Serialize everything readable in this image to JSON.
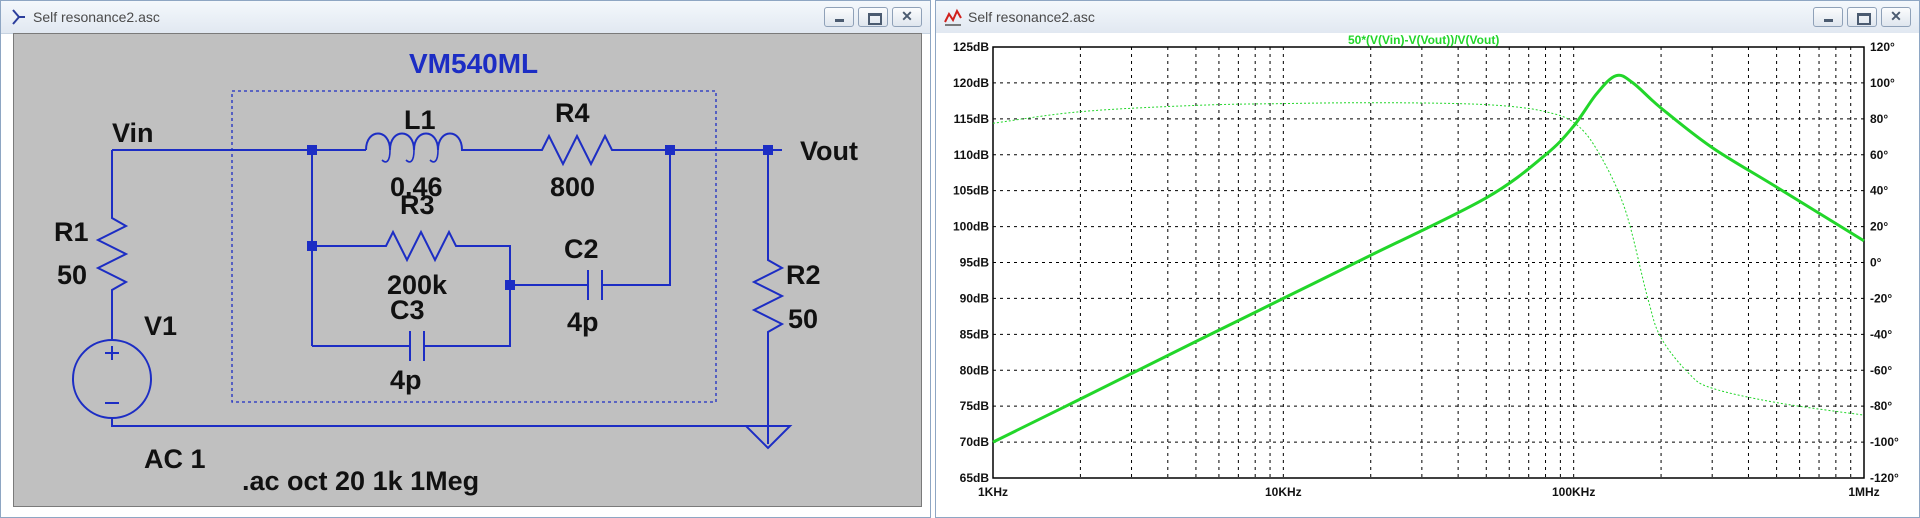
{
  "schematic_window": {
    "title": "Self resonance2.asc",
    "circuit_title": "VM540ML",
    "labels": {
      "vin": "Vin",
      "vout": "Vout",
      "r1_name": "R1",
      "r1_value": "50",
      "v1_name": "V1",
      "v1_value": "AC 1",
      "l1_name": "L1",
      "l1_value": "0.46",
      "r4_name": "R4",
      "r4_value": "800",
      "r3_name": "R3",
      "r3_value": "200k",
      "c2_name": "C2",
      "c2_value": "4p",
      "c3_name": "C3",
      "c3_value": "4p",
      "r2_name": "R2",
      "r2_value": "50",
      "directive": ".ac oct 20 1k 1Meg"
    },
    "colors": {
      "wire": "#1c2dc4",
      "component": "#1c2dc4",
      "background": "#c0c0c0"
    }
  },
  "plot_window": {
    "title": "Self resonance2.asc",
    "trace_label": "50*(V(Vin)-V(Vout))/V(Vout)",
    "colors": {
      "trace": "#22d62a",
      "grid": "#000000"
    },
    "chart_data": {
      "type": "line",
      "x_scale": "log",
      "xlim": [
        1000,
        1000000
      ],
      "x_ticks": [
        "1KHz",
        "10KHz",
        "100KHz",
        "1MHz"
      ],
      "x_tick_values": [
        1000,
        10000,
        100000,
        1000000
      ],
      "ylim_left": [
        65,
        125
      ],
      "y_ticks_left": [
        "125dB",
        "120dB",
        "115dB",
        "110dB",
        "105dB",
        "100dB",
        "95dB",
        "90dB",
        "85dB",
        "80dB",
        "75dB",
        "70dB",
        "65dB"
      ],
      "y_tick_values_left": [
        125,
        120,
        115,
        110,
        105,
        100,
        95,
        90,
        85,
        80,
        75,
        70,
        65
      ],
      "ylim_right": [
        -120,
        120
      ],
      "y_ticks_right": [
        "120°",
        "100°",
        "80°",
        "60°",
        "40°",
        "20°",
        "0°",
        "-20°",
        "-40°",
        "-60°",
        "-80°",
        "-100°",
        "-120°"
      ],
      "y_tick_values_right": [
        120,
        100,
        80,
        60,
        40,
        20,
        0,
        -20,
        -40,
        -60,
        -80,
        -100,
        -120
      ],
      "grid": true,
      "series": [
        {
          "name": "50*(V(Vin)-V(Vout))/V(Vout)",
          "axis": "left",
          "style": "solid",
          "x": [
            1000,
            2000,
            5000,
            10000,
            20000,
            50000,
            80000,
            100000,
            120000,
            140000,
            160000,
            200000,
            300000,
            500000,
            1000000
          ],
          "y": [
            70,
            76,
            84,
            90,
            96,
            104,
            110,
            114,
            118.5,
            121,
            120,
            116.5,
            111,
            105.5,
            98
          ]
        },
        {
          "name": "phase",
          "axis": "right",
          "style": "dashed",
          "x": [
            1000,
            2000,
            5000,
            10000,
            20000,
            40000,
            60000,
            80000,
            100000,
            120000,
            150000,
            180000,
            200000,
            250000,
            300000,
            500000,
            1000000
          ],
          "y": [
            77.5,
            84,
            87.5,
            88.5,
            89,
            88.5,
            87,
            84,
            78,
            63,
            30,
            -20,
            -42,
            -62,
            -70,
            -78,
            -85
          ]
        }
      ]
    }
  }
}
